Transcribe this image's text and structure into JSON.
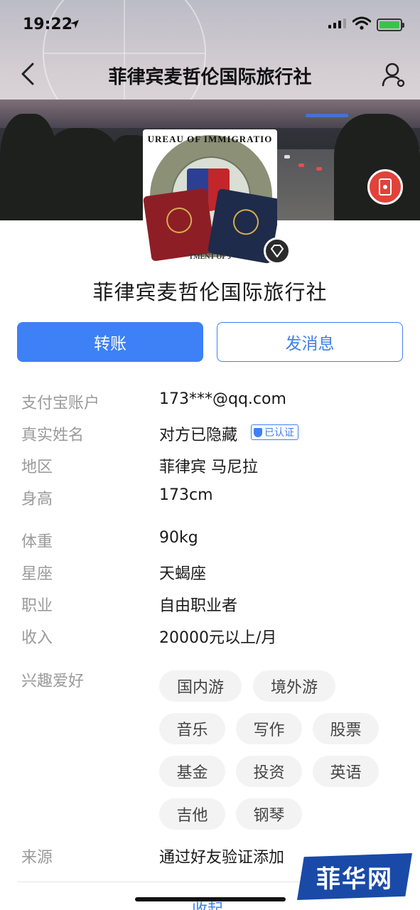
{
  "status_bar": {
    "time": "19:22"
  },
  "nav": {
    "title": "菲律宾麦哲伦国际旅行社"
  },
  "avatar": {
    "seal_text": "UREAU OF IMMIGRATIO",
    "seal_bottom": "TMENT OF J"
  },
  "profile": {
    "name": "菲律宾麦哲伦国际旅行社"
  },
  "actions": {
    "transfer_label": "转账",
    "message_label": "发消息"
  },
  "info": [
    {
      "label": "支付宝账户",
      "value": "173***@qq.com"
    },
    {
      "label": "真实姓名",
      "value": "对方已隐藏",
      "tag": "已认证"
    },
    {
      "label": "地区",
      "value": "菲律宾 马尼拉"
    },
    {
      "label": "身高",
      "value": "173cm"
    },
    {
      "label": "体重",
      "value": "90kg"
    },
    {
      "label": "星座",
      "value": "天蝎座"
    },
    {
      "label": "职业",
      "value": "自由职业者"
    },
    {
      "label": "收入",
      "value": "20000元以上/月"
    }
  ],
  "hobbies": {
    "label": "兴趣爱好",
    "tags": [
      "国内游",
      "境外游",
      "音乐",
      "写作",
      "股票",
      "基金",
      "投资",
      "英语",
      "吉他",
      "钢琴"
    ]
  },
  "source": {
    "label": "来源",
    "value": "通过好友验证添加"
  },
  "footer": {
    "collapse_label": "收起"
  },
  "watermark": {
    "text": "菲华网"
  },
  "colors": {
    "accent": "#3e80f6",
    "label_gray": "#9a9a9a",
    "tag_bg": "#f3f3f3",
    "redpacket": "#e0433a"
  }
}
